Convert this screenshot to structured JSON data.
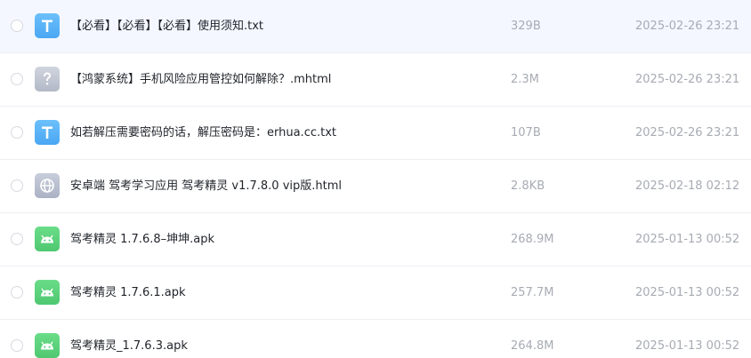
{
  "files": [
    {
      "name": "【必看】【必看】【必看】使用须知.txt",
      "size": "329B",
      "date": "2025-02-26 23:21",
      "icon": "text-file-icon",
      "icon_color": "#5bb3f7"
    },
    {
      "name": "【鸿蒙系统】手机风险应用管控如何解除？.mhtml",
      "size": "2.3M",
      "date": "2025-02-26 23:21",
      "icon": "unknown-file-icon",
      "icon_color": "#c1c6d3"
    },
    {
      "name": "如若解压需要密码的话，解压密码是：erhua.cc.txt",
      "size": "107B",
      "date": "2025-02-26 23:21",
      "icon": "text-file-icon",
      "icon_color": "#5bb3f7"
    },
    {
      "name": "安卓端 驾考学习应用 驾考精灵 v1.7.8.0 vip版.html",
      "size": "2.8KB",
      "date": "2025-02-18 02:12",
      "icon": "web-file-icon",
      "icon_color": "#b8bfd0"
    },
    {
      "name": "驾考精灵 1.7.6.8–坤坤.apk",
      "size": "268.9M",
      "date": "2025-01-13 00:52",
      "icon": "android-apk-icon",
      "icon_color": "#5fd47e"
    },
    {
      "name": "驾考精灵 1.7.6.1.apk",
      "size": "257.7M",
      "date": "2025-01-13 00:52",
      "icon": "android-apk-icon",
      "icon_color": "#5fd47e"
    },
    {
      "name": "驾考精灵_1.7.6.3.apk",
      "size": "264.8M",
      "date": "2025-01-13 00:52",
      "icon": "android-apk-icon",
      "icon_color": "#5fd47e"
    }
  ]
}
